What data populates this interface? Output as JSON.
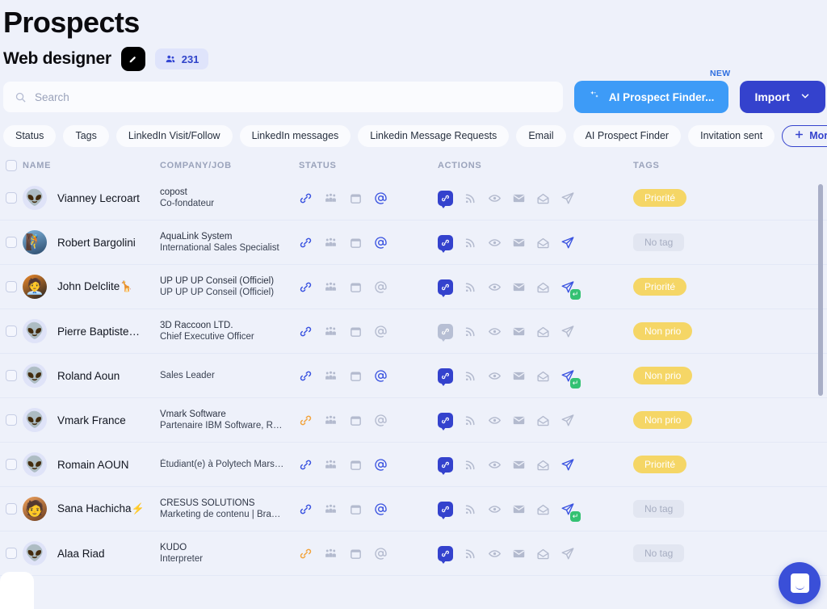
{
  "header": {
    "title": "Prospects",
    "subtitle": "Web designer",
    "badge_icon": "pen-icon",
    "count_icon": "group-icon",
    "count": "231"
  },
  "search": {
    "placeholder": "Search",
    "value": "",
    "icon": "search-icon"
  },
  "actions": {
    "ai_finder_label": "AI Prospect Finder...",
    "ai_finder_icon": "sparkle-icon",
    "ai_finder_new_flag": "NEW",
    "import_label": "Import",
    "import_icon": "chevron-down-icon",
    "ai_color": "#3d9bf7",
    "import_color": "#3442cd"
  },
  "filters": {
    "chips": [
      "Status",
      "Tags",
      "LinkedIn Visit/Follow",
      "LinkedIn messages",
      "Linkedin Message Requests",
      "Email",
      "AI Prospect Finder",
      "Invitation sent"
    ],
    "more_label": "More filters",
    "more_icon": "plus-icon"
  },
  "table": {
    "columns": [
      "NAME",
      "COMPANY/JOB",
      "STATUS",
      "ACTIONS",
      "TAGS"
    ],
    "tag_none_label": "No tag",
    "rows": [
      {
        "name": "Vianney Lecroart",
        "name_emoji": "",
        "avatar": "alien",
        "company": "copost",
        "job": "Co-fondateur",
        "status": {
          "link": "blue",
          "people": "gray",
          "calendar": "gray",
          "at": "blue"
        },
        "actions": {
          "link_badge": "on",
          "rss": "gray",
          "eye": "gray",
          "mail": "gray",
          "open_mail": "gray",
          "send": "gray",
          "replied": false
        },
        "tag": "Priorité",
        "tag_type": "prio"
      },
      {
        "name": "Robert Bargolini",
        "name_emoji": "",
        "avatar": "photo-man-blue",
        "company": "AquaLink System",
        "job": "International Sales Specialist",
        "status": {
          "link": "blue",
          "people": "gray",
          "calendar": "gray",
          "at": "blue"
        },
        "actions": {
          "link_badge": "on",
          "rss": "gray",
          "eye": "gray",
          "mail": "gray",
          "open_mail": "gray",
          "send": "blue",
          "replied": false
        },
        "tag": "No tag",
        "tag_type": "none"
      },
      {
        "name": "John Delclite",
        "name_emoji": "🦒",
        "avatar": "photo-man-orange",
        "company": "UP UP UP Conseil (Officiel)",
        "job": "UP UP UP Conseil (Officiel)",
        "status": {
          "link": "blue",
          "people": "gray",
          "calendar": "gray",
          "at": "gray"
        },
        "actions": {
          "link_badge": "on",
          "rss": "gray",
          "eye": "gray",
          "mail": "gray",
          "open_mail": "gray",
          "send": "blue",
          "replied": true
        },
        "tag": "Priorité",
        "tag_type": "prio"
      },
      {
        "name": "Pierre Baptiste…",
        "name_emoji": "",
        "avatar": "alien",
        "company": "3D Raccoon LTD.",
        "job": "Chief Executive Officer",
        "status": {
          "link": "blue",
          "people": "gray",
          "calendar": "gray",
          "at": "gray"
        },
        "actions": {
          "link_badge": "off",
          "rss": "gray",
          "eye": "gray",
          "mail": "gray",
          "open_mail": "gray",
          "send": "gray",
          "replied": false
        },
        "tag": "Non prio",
        "tag_type": "prio"
      },
      {
        "name": "Roland Aoun",
        "name_emoji": "",
        "avatar": "alien",
        "company": "",
        "job": "Sales Leader",
        "status": {
          "link": "blue",
          "people": "gray",
          "calendar": "gray",
          "at": "blue"
        },
        "actions": {
          "link_badge": "on",
          "rss": "gray",
          "eye": "gray",
          "mail": "gray",
          "open_mail": "gray",
          "send": "blue",
          "replied": true
        },
        "tag": "Non prio",
        "tag_type": "prio"
      },
      {
        "name": "Vmark France",
        "name_emoji": "",
        "avatar": "alien",
        "company": "Vmark Software",
        "job": "Partenaire IBM Software, R…",
        "status": {
          "link": "orange",
          "people": "gray",
          "calendar": "gray",
          "at": "gray"
        },
        "actions": {
          "link_badge": "on",
          "rss": "gray",
          "eye": "gray",
          "mail": "gray",
          "open_mail": "gray",
          "send": "gray",
          "replied": false
        },
        "tag": "Non prio",
        "tag_type": "prio"
      },
      {
        "name": "Romain AOUN",
        "name_emoji": "",
        "avatar": "alien",
        "company": "",
        "job": "Étudiant(e) à Polytech Mars…",
        "status": {
          "link": "blue",
          "people": "gray",
          "calendar": "gray",
          "at": "blue"
        },
        "actions": {
          "link_badge": "on",
          "rss": "gray",
          "eye": "gray",
          "mail": "gray",
          "open_mail": "gray",
          "send": "blue",
          "replied": false
        },
        "tag": "Priorité",
        "tag_type": "prio"
      },
      {
        "name": "Sana Hachicha",
        "name_emoji": "⚡",
        "avatar": "photo-woman",
        "company": "CRESUS SOLUTIONS",
        "job": "Marketing de contenu | Bra…",
        "status": {
          "link": "blue",
          "people": "gray",
          "calendar": "gray",
          "at": "blue"
        },
        "actions": {
          "link_badge": "on",
          "rss": "gray",
          "eye": "gray",
          "mail": "gray",
          "open_mail": "gray",
          "send": "blue",
          "replied": true
        },
        "tag": "No tag",
        "tag_type": "none"
      },
      {
        "name": "Alaa Riad",
        "name_emoji": "",
        "avatar": "alien",
        "company": "KUDO",
        "job": "Interpreter",
        "status": {
          "link": "orange",
          "people": "gray",
          "calendar": "gray",
          "at": "gray"
        },
        "actions": {
          "link_badge": "on",
          "rss": "gray",
          "eye": "gray",
          "mail": "gray",
          "open_mail": "gray",
          "send": "gray",
          "replied": false
        },
        "tag": "No tag",
        "tag_type": "none"
      }
    ]
  },
  "chat": {
    "icon": "chat-bubble-icon"
  },
  "colors": {
    "accent": "#3442cd",
    "ai": "#3d9bf7",
    "tag_prio": "#f5d666",
    "bg": "#eef1fa",
    "link_orange": "#f2a33c"
  }
}
